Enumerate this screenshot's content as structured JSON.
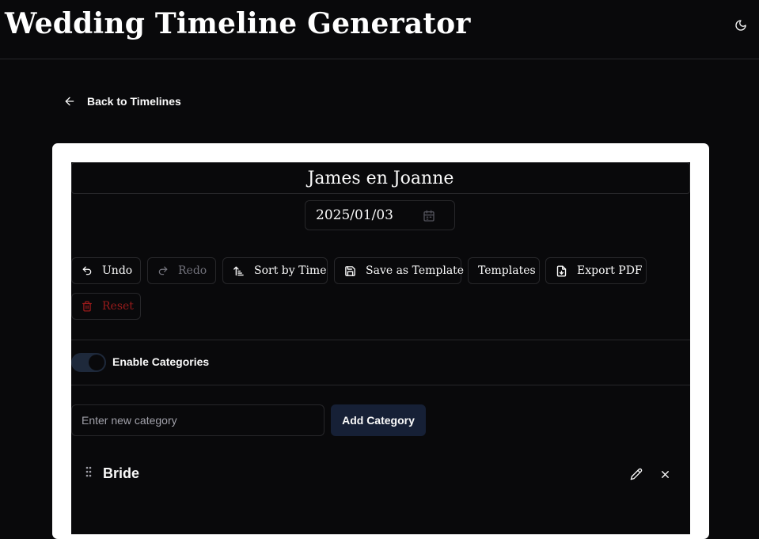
{
  "header": {
    "title": "Wedding Timeline Generator",
    "theme_icon": "moon-icon"
  },
  "nav": {
    "back_label": "Back to Timelines"
  },
  "timeline": {
    "name": "James en Joanne",
    "date": "2025/01/03"
  },
  "toolbar": {
    "undo": "Undo",
    "redo": "Redo",
    "sort": "Sort by Time",
    "save_template": "Save as Template",
    "templates": "Templates",
    "export_pdf": "Export PDF",
    "reset": "Reset"
  },
  "categories": {
    "toggle_label": "Enable Categories",
    "toggle_on": true,
    "input_placeholder": "Enter new category",
    "add_label": "Add Category",
    "items": [
      {
        "name": "Bride"
      }
    ]
  },
  "colors": {
    "background": "#09090b",
    "card": "#ffffff",
    "border": "#27272a",
    "danger": "#991b1b",
    "accent": "#162036"
  }
}
